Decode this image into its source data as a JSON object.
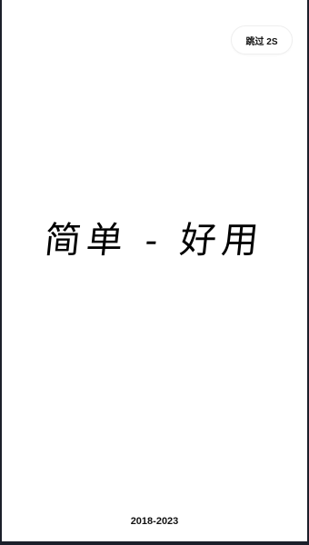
{
  "splash": {
    "skip_label": "跳过 2S",
    "slogan": "简单 - 好用",
    "copyright": "2018-2023"
  }
}
